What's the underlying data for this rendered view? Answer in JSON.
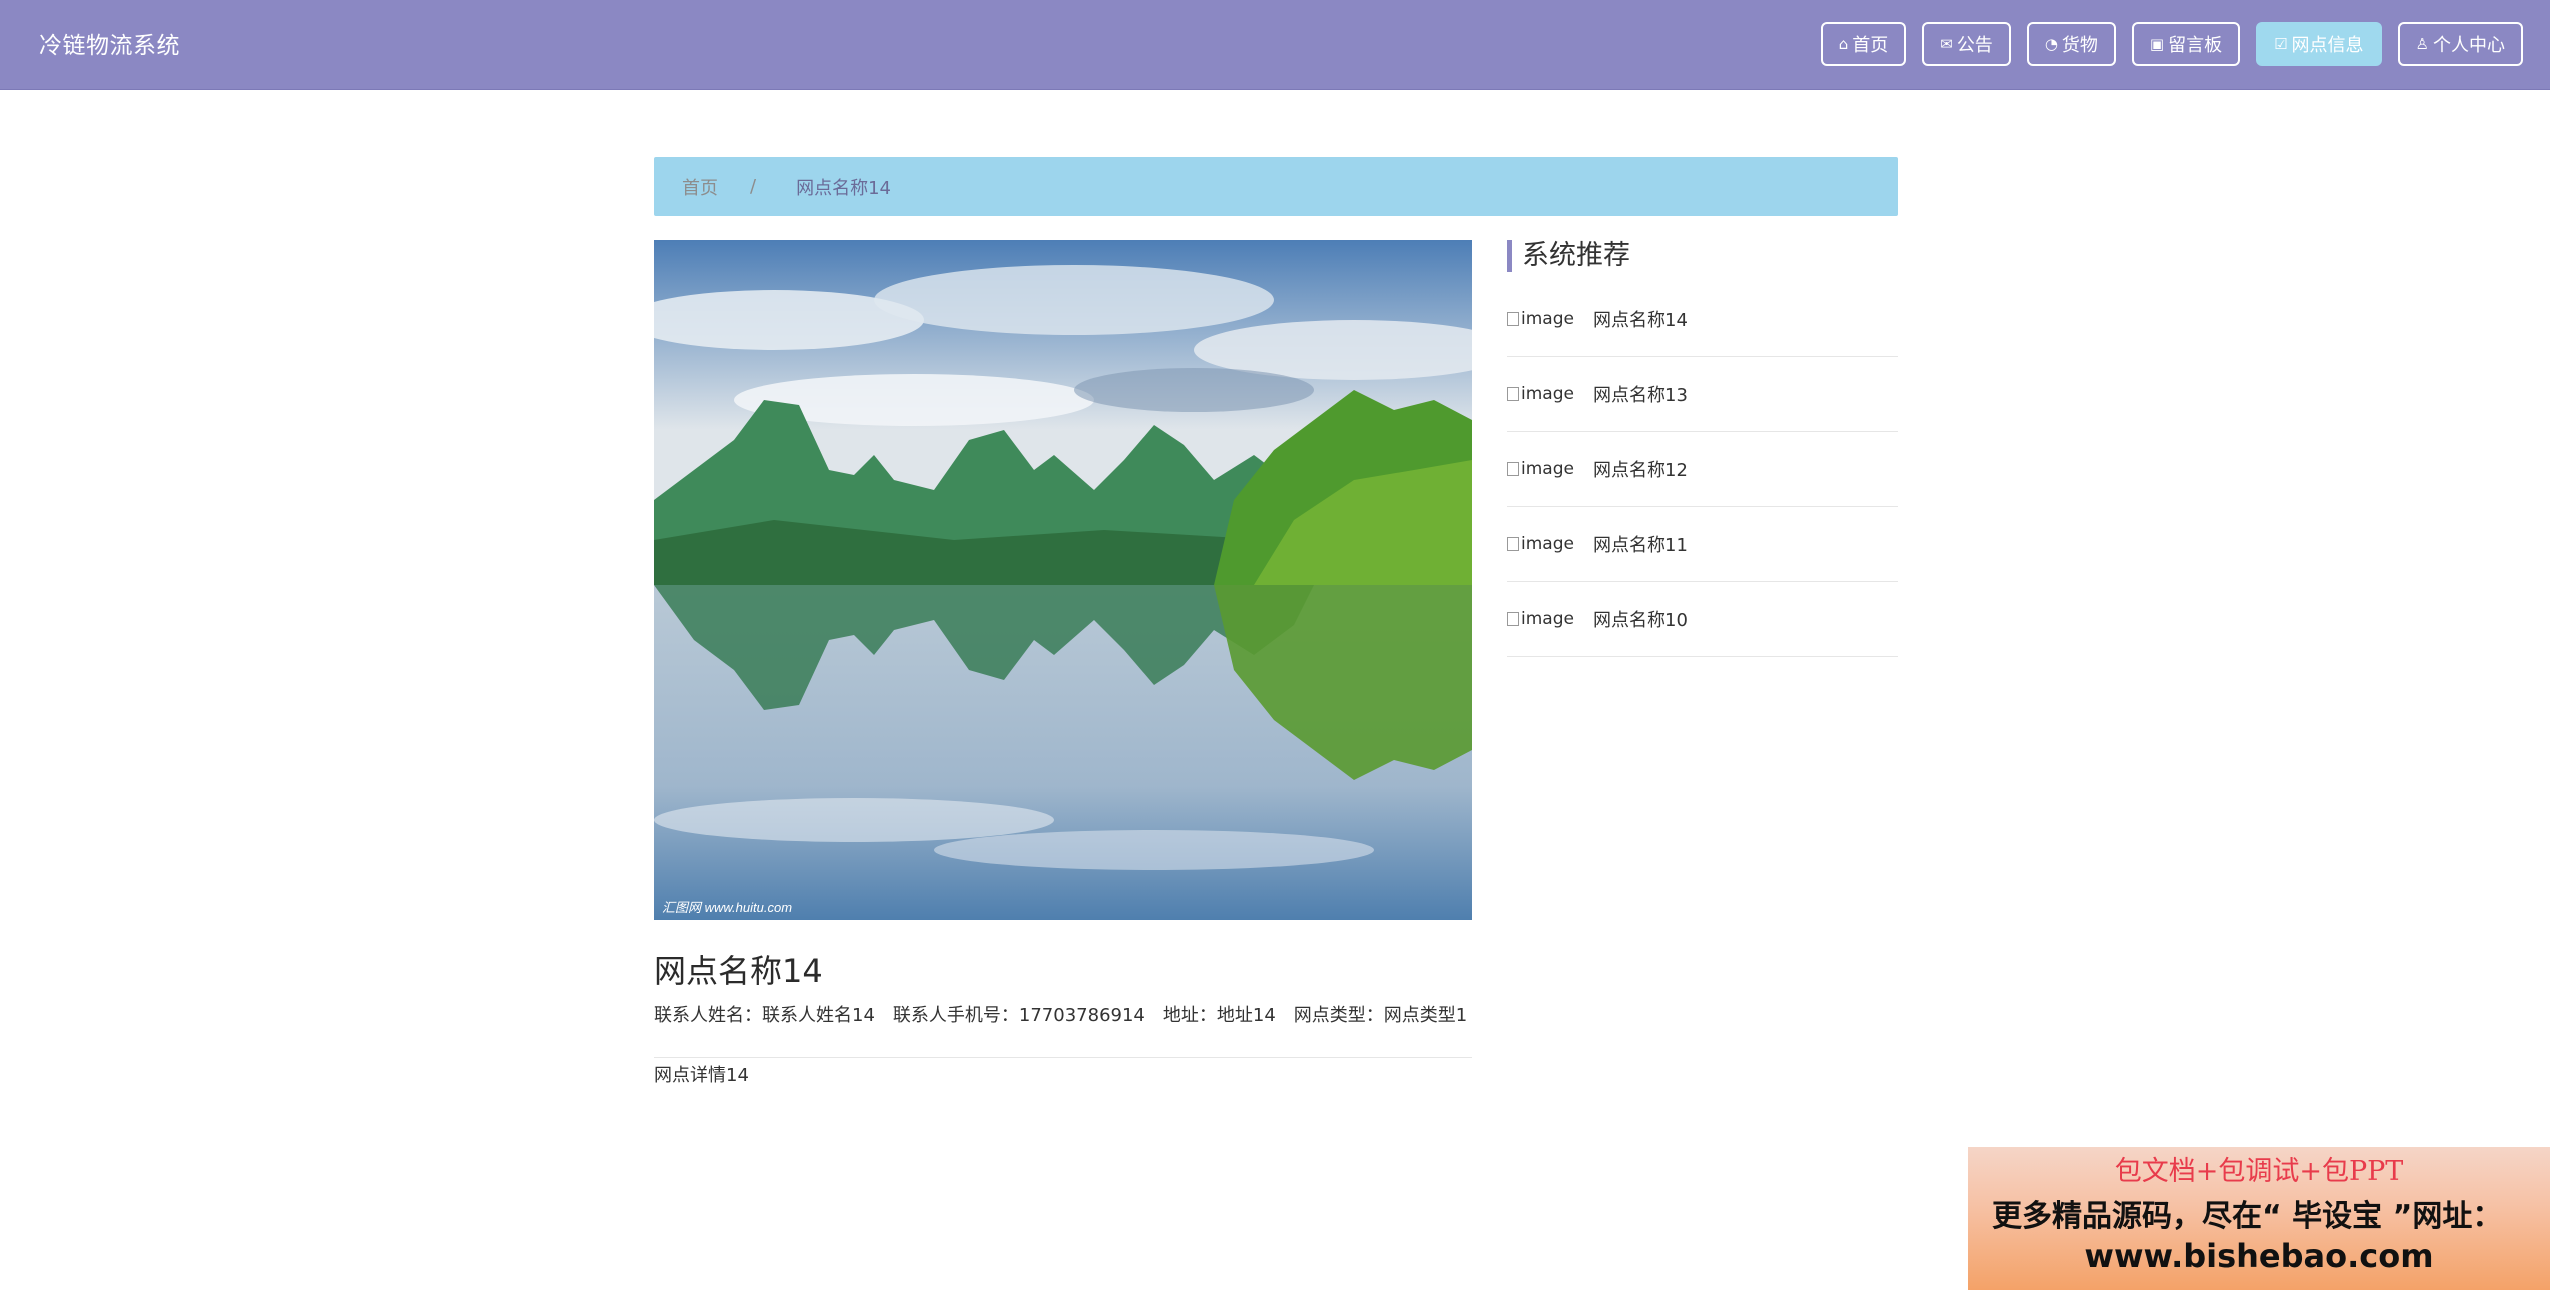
{
  "header": {
    "brand": "冷链物流系统",
    "nav": [
      {
        "label": "首页",
        "icon": "home-icon",
        "glyph": "⌂",
        "active": false
      },
      {
        "label": "公告",
        "icon": "mail-icon",
        "glyph": "✉",
        "active": false
      },
      {
        "label": "货物",
        "icon": "gauge-icon",
        "glyph": "◔",
        "active": false
      },
      {
        "label": "留言板",
        "icon": "board-icon",
        "glyph": "▣",
        "active": false
      },
      {
        "label": "网点信息",
        "icon": "outlet-icon",
        "glyph": "☑",
        "active": true
      },
      {
        "label": "个人中心",
        "icon": "user-icon",
        "glyph": "♙",
        "active": false
      }
    ]
  },
  "breadcrumb": {
    "home": "首页",
    "separator": "/",
    "current": "网点名称14"
  },
  "detail": {
    "image_watermark": "汇图网 www.huitu.com",
    "title": "网点名称14",
    "contact_name_label": "联系人姓名：",
    "contact_name": "联系人姓名14",
    "contact_phone_label": "联系人手机号：",
    "contact_phone": "17703786914",
    "address_label": "地址：",
    "address": "地址14",
    "type_label": "网点类型：",
    "type": "网点类型1",
    "description": "网点详情14"
  },
  "sidebar": {
    "title": "系统推荐",
    "image_alt": "image",
    "items": [
      {
        "name": "网点名称14"
      },
      {
        "name": "网点名称13"
      },
      {
        "name": "网点名称12"
      },
      {
        "name": "网点名称11"
      },
      {
        "name": "网点名称10"
      }
    ]
  },
  "ad": {
    "line1": "包文档+包调试+包PPT",
    "line2": "更多精品源码，尽在“ 毕设宝 ”网址：",
    "line3": "www.bishebao.com"
  },
  "colors": {
    "header_bg": "#8b88c3",
    "nav_active_bg": "#9fd9ee",
    "breadcrumb_bg": "#9dd5ed"
  }
}
